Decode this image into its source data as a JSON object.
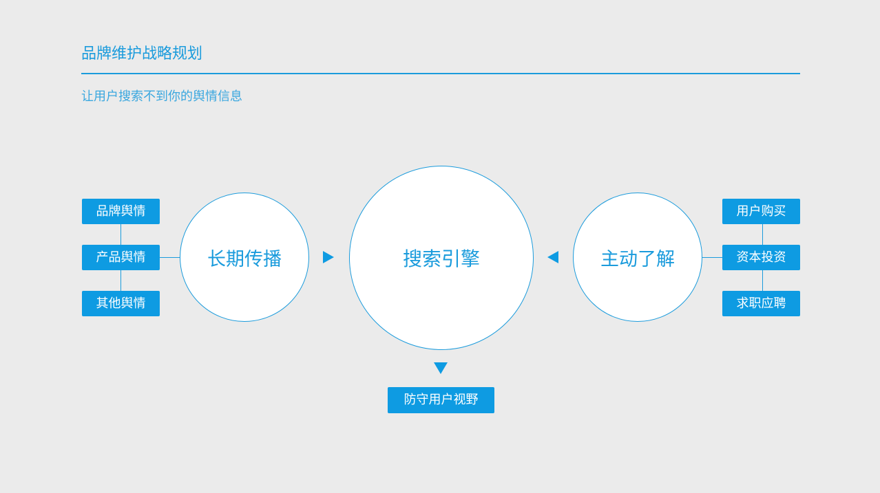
{
  "header": {
    "title": "品牌维护战略规划",
    "subtitle": "让用户搜索不到你的舆情信息"
  },
  "diagram": {
    "left_circle": "长期传播",
    "center_circle": "搜索引擎",
    "right_circle": "主动了解",
    "left_items": [
      "品牌舆情",
      "产品舆情",
      "其他舆情"
    ],
    "right_items": [
      "用户购买",
      "资本投资",
      "求职应聘"
    ],
    "bottom_item": "防守用户视野"
  },
  "colors": {
    "accent": "#1a9bdc",
    "box_fill": "#0e9be2",
    "background": "#ebebeb",
    "circle_fill": "#ffffff"
  },
  "icons": {
    "arrow_into_center_from_left": "triangle-right-icon",
    "arrow_into_center_from_right": "triangle-left-icon",
    "arrow_down_from_center": "triangle-down-icon"
  }
}
